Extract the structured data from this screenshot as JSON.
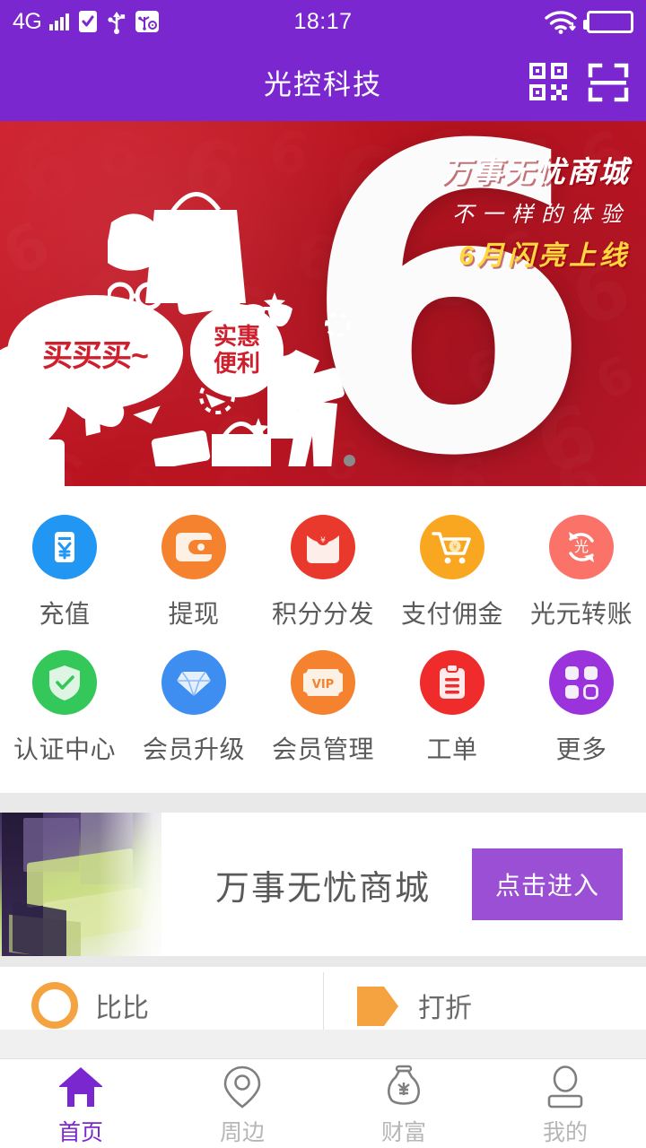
{
  "status_bar": {
    "network": "4G",
    "time": "18:17",
    "icons": [
      "signal-bars-icon",
      "clipboard-check-icon",
      "usb-icon",
      "usb-debug-icon",
      "wifi-icon",
      "battery-icon"
    ]
  },
  "header": {
    "title": "光控科技",
    "actions": [
      {
        "name": "qr-code-icon",
        "label": "二维码"
      },
      {
        "name": "scan-icon",
        "label": "扫一扫"
      }
    ]
  },
  "banner": {
    "headline": "万事无忧商城",
    "subhead": "不一样的体验",
    "tagline": "6月闪亮上线",
    "bubble_left": "买买买~",
    "bubble_right_line1": "实惠",
    "bubble_right_line2": "便利",
    "big_number": "6",
    "bg_color": "#c2182a",
    "tagline_color": "#ffd73e",
    "dots": {
      "count": 3,
      "active_index": 2
    }
  },
  "grid": {
    "rows": [
      [
        {
          "label": "充值",
          "icon": "recharge-icon",
          "color": "#2196f3"
        },
        {
          "label": "提现",
          "icon": "wallet-icon",
          "color": "#f5822e"
        },
        {
          "label": "积分分发",
          "icon": "red-envelope-icon",
          "color": "#e8392c"
        },
        {
          "label": "支付佣金",
          "icon": "shopping-cart-icon",
          "color": "#f9a620"
        },
        {
          "label": "光元转账",
          "icon": "transfer-icon",
          "color": "#fa7268"
        }
      ],
      [
        {
          "label": "认证中心",
          "icon": "shield-check-icon",
          "color": "#34c759"
        },
        {
          "label": "会员升级",
          "icon": "diamond-icon",
          "color": "#3d8ef0"
        },
        {
          "label": "会员管理",
          "icon": "vip-ticket-icon",
          "color": "#f5822e"
        },
        {
          "label": "工单",
          "icon": "clipboard-list-icon",
          "color": "#f02b2b"
        },
        {
          "label": "更多",
          "icon": "more-grid-icon",
          "color": "#9b33dd"
        }
      ]
    ]
  },
  "mall_card": {
    "title": "万事无忧商城",
    "button_label": "点击进入",
    "button_color": "#9b4fd4",
    "thumbnail": "mall-photo"
  },
  "mini_cards": [
    {
      "label": "比比",
      "icon": "circle-orange-icon"
    },
    {
      "label": "打折",
      "icon": "tag-orange-icon"
    }
  ],
  "tabbar": {
    "active_index": 0,
    "items": [
      {
        "label": "首页",
        "icon": "home-icon"
      },
      {
        "label": "周边",
        "icon": "location-pin-icon"
      },
      {
        "label": "财富",
        "icon": "money-bag-icon"
      },
      {
        "label": "我的",
        "icon": "user-icon"
      }
    ],
    "active_color": "#7b27cf",
    "inactive_color": "#b6b6b6"
  }
}
